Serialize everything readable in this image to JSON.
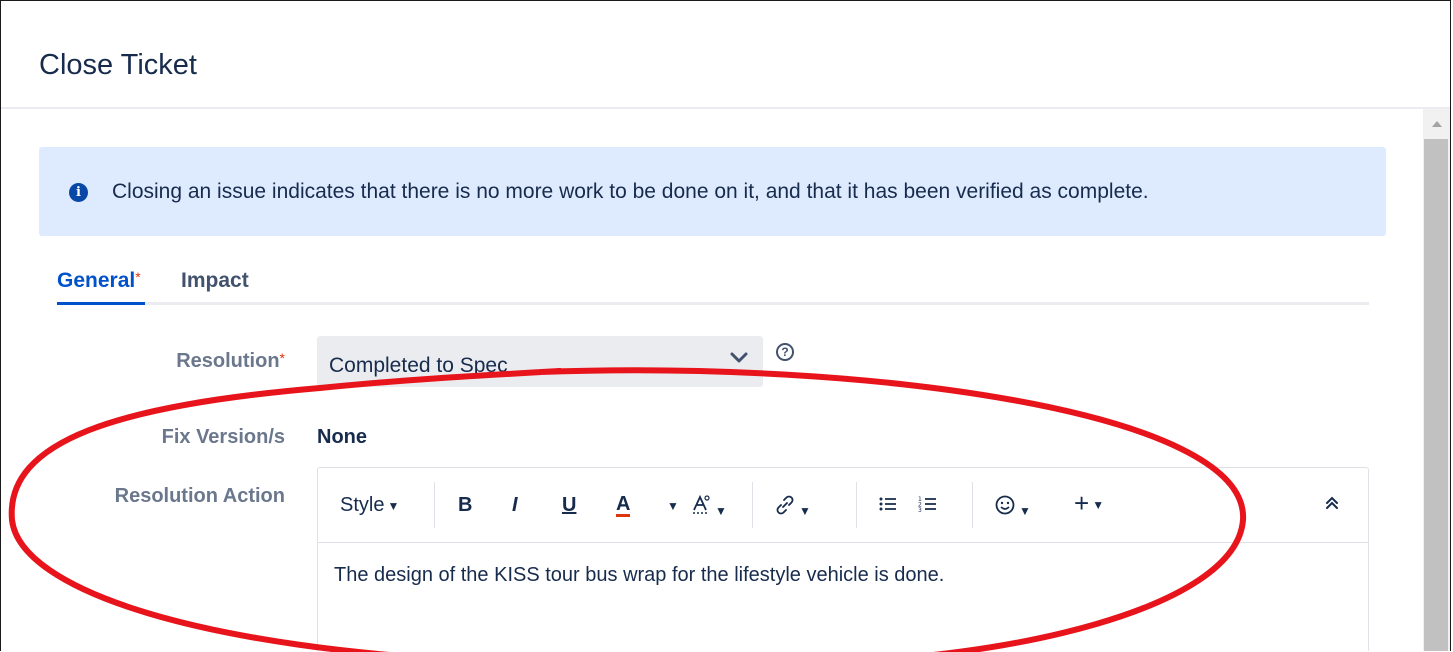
{
  "dialog": {
    "title": "Close Ticket",
    "info_message": "Closing an issue indicates that there is no more work to be done on it, and that it has been verified as complete."
  },
  "tabs": [
    {
      "label": "General",
      "required_marker": "*"
    },
    {
      "label": "Impact"
    }
  ],
  "form": {
    "resolution": {
      "label": "Resolution",
      "required_marker": "*",
      "value": "Completed to Spec"
    },
    "fix_version": {
      "label": "Fix Version/s",
      "value": "None"
    },
    "resolution_action": {
      "label": "Resolution Action",
      "toolbar": {
        "style_label": "Style",
        "bold": "B",
        "italic": "I",
        "underline": "U",
        "text_color": "A",
        "list_bullet": "☰",
        "list_numbered": "☷",
        "insert": "+"
      },
      "content": "The design of the KISS tour bus wrap for the lifestyle vehicle is done."
    }
  },
  "colors": {
    "accent": "#0052cc",
    "info_bg": "#deebff",
    "annotation": "#e8141c",
    "required": "#de350b"
  }
}
